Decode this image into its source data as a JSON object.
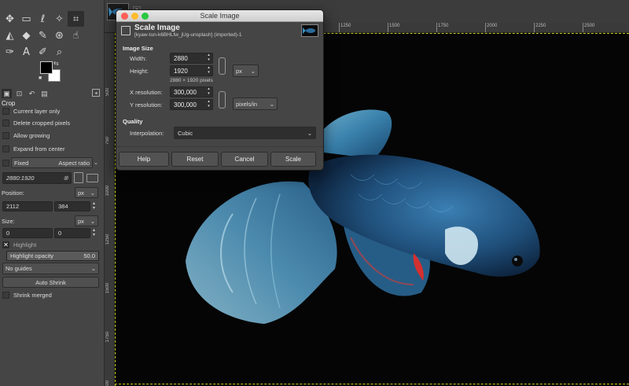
{
  "toolbox": {
    "tools": [
      [
        "move-icon",
        "rect-select-icon",
        "lasso-icon",
        "fuzzy-select-icon",
        "crop-icon"
      ],
      [
        "warp-icon",
        "bucket-icon",
        "paintbrush-icon",
        "clone-icon",
        "smudge-icon"
      ],
      [
        "path-icon",
        "text-icon",
        "color-picker-icon",
        "zoom-icon"
      ]
    ],
    "tool_glyphs": [
      [
        "✥",
        "▭",
        "ℓ",
        "✧",
        "⌗"
      ],
      [
        "◭",
        "◆",
        "✎",
        "⊛",
        "☝"
      ],
      [
        "✑",
        "A",
        "✐",
        "⌕"
      ]
    ],
    "fg_color": "#000000",
    "bg_color": "#ffffff"
  },
  "tool_options": {
    "title": "Crop",
    "current_layer_only": "Current layer only",
    "delete_cropped_pixels": "Delete cropped pixels",
    "allow_growing": "Allow growing",
    "expand_from_center": "Expand from center",
    "fixed_label": "Fixed",
    "aspect_mode": "Aspect ratio",
    "aspect_value": "2880:1920",
    "position_label": "Position:",
    "position_unit": "px",
    "position_x": "2112",
    "position_y": "384",
    "size_label": "Size:",
    "size_unit": "px",
    "size_w": "0",
    "size_h": "0",
    "highlight_label": "Highlight",
    "highlight_opacity_label": "Highlight opacity",
    "highlight_opacity_value": "50.0",
    "guides": "No guides",
    "auto_shrink": "Auto Shrink",
    "shrink_merged": "Shrink merged"
  },
  "rulers": {
    "top_ticks": [
      "1250",
      "1500",
      "1750",
      "2000",
      "2250",
      "2500",
      "2750",
      "3000"
    ],
    "left_ticks": [
      "500",
      "750",
      "1000",
      "1250",
      "1500",
      "1750",
      "2000"
    ]
  },
  "dialog": {
    "window_title": "Scale Image",
    "heading": "Scale Image",
    "subheading": "[kyaw-tun-k6BHLfw_jUg-unsplash] (imported)-1",
    "image_size_title": "Image Size",
    "width_label": "Width:",
    "width_value": "2880",
    "height_label": "Height:",
    "height_value": "1920",
    "size_unit": "px",
    "pixel_dims": "2880 × 1920 pixels",
    "x_res_label": "X resolution:",
    "x_res_value": "300,000",
    "y_res_label": "Y resolution:",
    "y_res_value": "300,000",
    "res_unit": "pixels/in",
    "quality_title": "Quality",
    "interp_label": "Interpolation:",
    "interp_value": "Cubic",
    "help": "Help",
    "reset": "Reset",
    "cancel": "Cancel",
    "scale": "Scale"
  },
  "colors": {
    "traffic_close": "#ff5f57",
    "traffic_min": "#febc2e",
    "traffic_max": "#28c840",
    "selection_border": "#c8c820"
  }
}
